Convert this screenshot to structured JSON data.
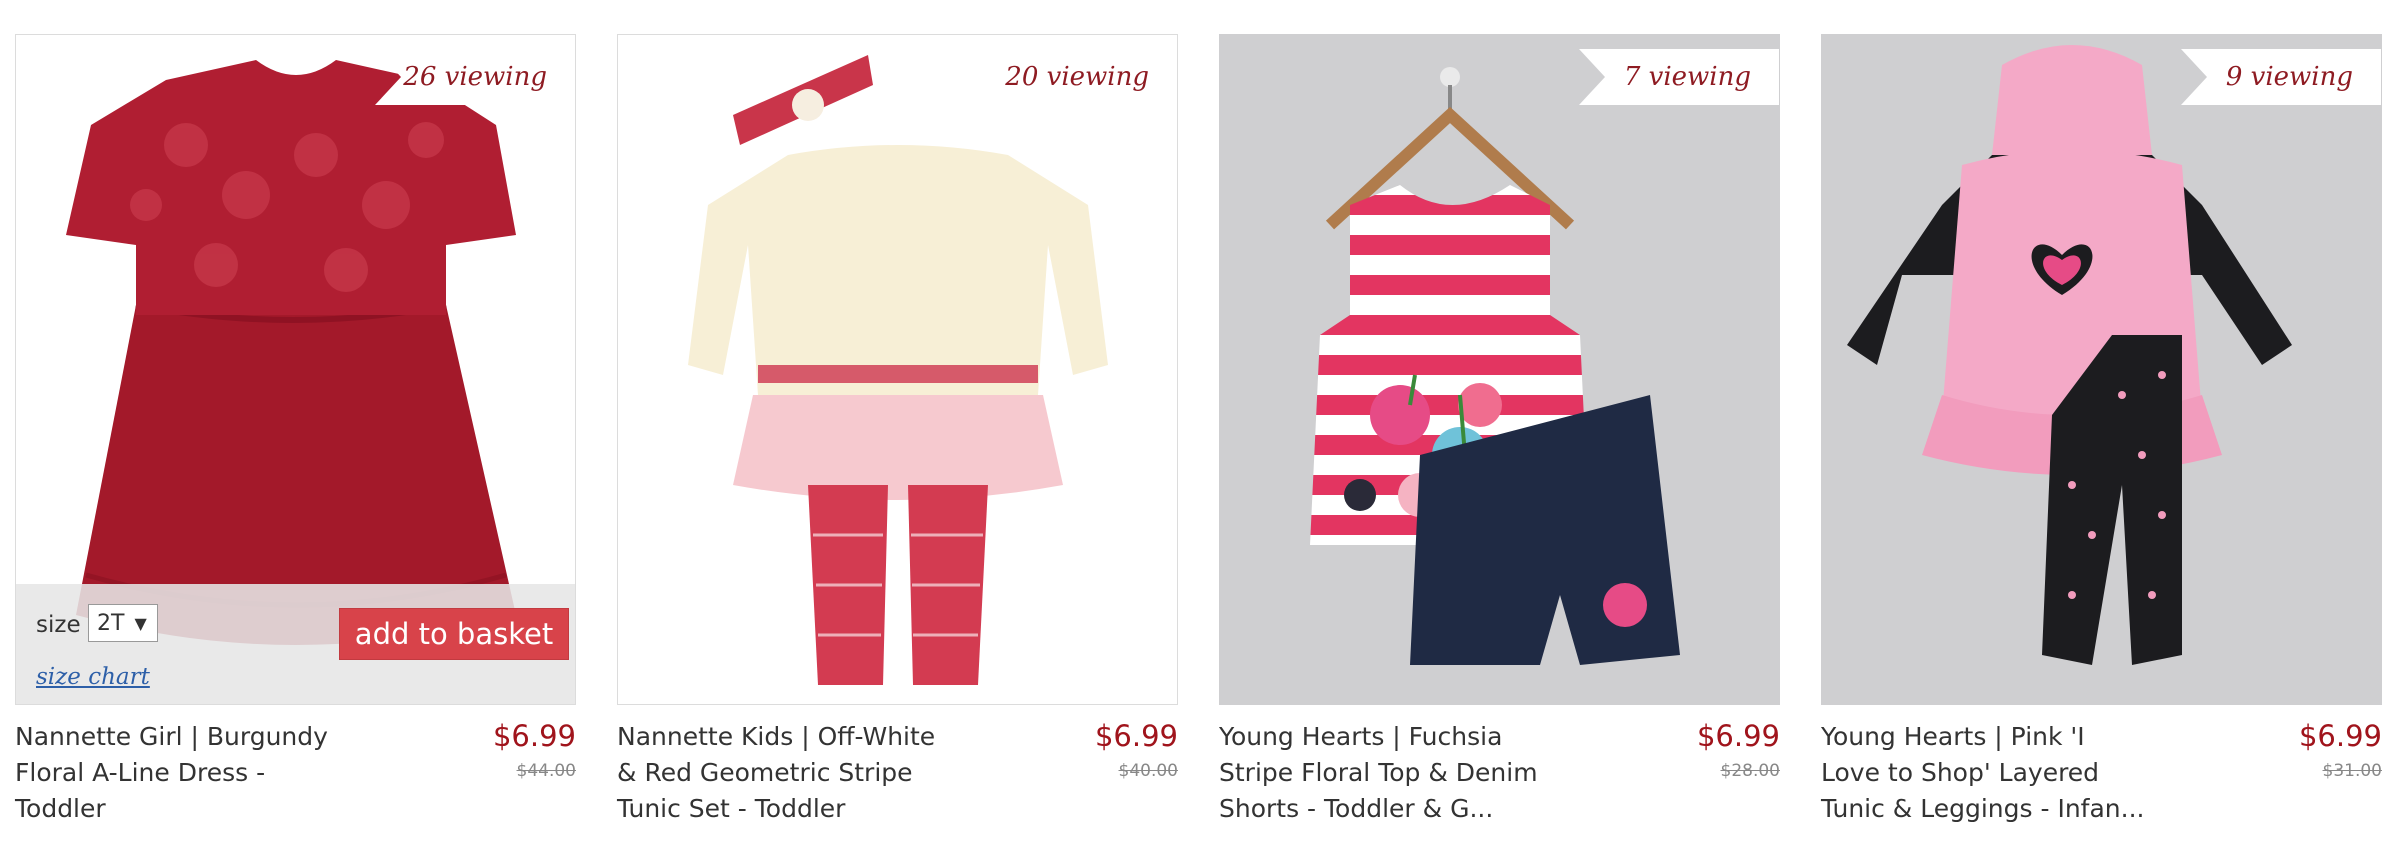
{
  "products": [
    {
      "viewing": "26 viewing",
      "title": "Nannette Girl | Burgundy Floral A-Line Dress - Toddler",
      "price": "$6.99",
      "original_price": "$44.00",
      "image": "burgundy-lace-dress"
    },
    {
      "viewing": "20 viewing",
      "title": "Nannette Kids | Off-White & Red Geometric Stripe Tunic Set - Toddler",
      "price": "$6.99",
      "original_price": "$40.00",
      "image": "off-white-tunic-set"
    },
    {
      "viewing": "7 viewing",
      "title": "Young Hearts | Fuchsia Stripe Floral Top & Denim Shorts - Toddler & G...",
      "price": "$6.99",
      "original_price": "$28.00",
      "image": "fuchsia-stripe-top-denim-shorts"
    },
    {
      "viewing": "9 viewing",
      "title": "Young Hearts | Pink 'I Love to Shop' Layered Tunic & Leggings - Infan...",
      "price": "$6.99",
      "original_price": "$31.00",
      "image": "pink-hoodie-tunic-leggings"
    }
  ],
  "quick_add": {
    "size_label": "size",
    "size_value": "2T",
    "add_label": "add to basket",
    "size_chart_label": "size chart"
  },
  "colors": {
    "price": "#a0141c",
    "viewing": "#8e1b22",
    "add_button": "#d8434a",
    "link": "#2d5fa8"
  }
}
